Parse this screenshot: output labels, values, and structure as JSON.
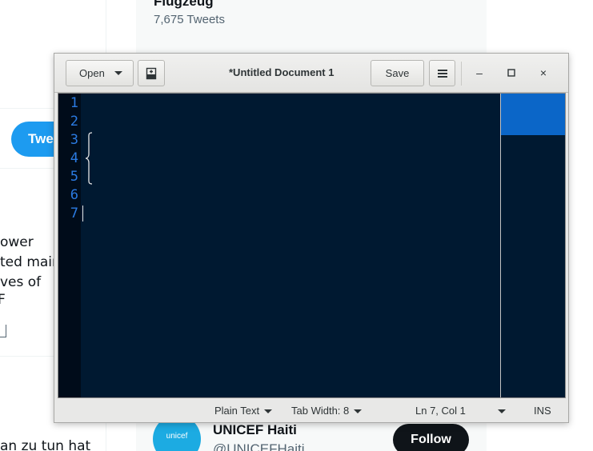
{
  "background": {
    "profile_name": "Flugzeug",
    "tweet_count": "7,675 Tweets",
    "tweet_button_label": "Twe",
    "tweet_text_lines": [
      "ower",
      "ted main",
      "ves of",
      "F"
    ],
    "bottom_left_text": "an zu tun hat",
    "suggested_account": {
      "avatar_text": "unicef",
      "name": "UNICEF Haiti",
      "handle": "@UNICEFHaiti",
      "follow_label": "Follow"
    }
  },
  "window": {
    "open_label": "Open",
    "title": "*Untitled Document 1",
    "save_label": "Save",
    "minimize_glyph": "–",
    "maximize_glyph": "□",
    "close_glyph": "×"
  },
  "editor": {
    "line_numbers": [
      "1",
      "2",
      "3",
      "4",
      "5",
      "6",
      "7"
    ],
    "background_color": "#001931",
    "line_number_color": "#2b7be2"
  },
  "statusbar": {
    "language": "Plain Text",
    "tab_width": "Tab Width: 8",
    "position": "Ln 7, Col 1",
    "mode": "INS"
  }
}
